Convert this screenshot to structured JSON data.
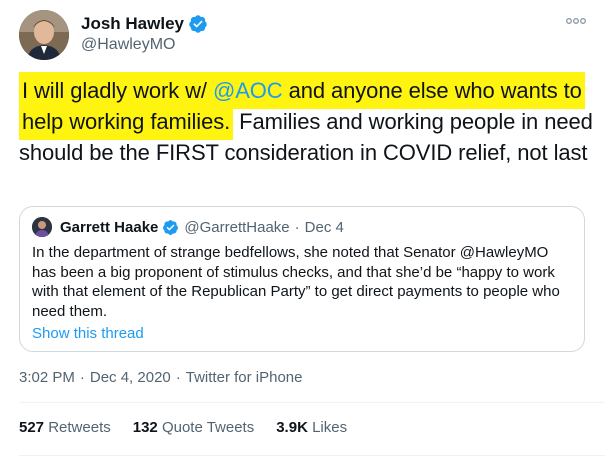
{
  "author": {
    "name": "Josh Hawley",
    "handle": "@HawleyMO",
    "avatar_icon": "avatar-photo",
    "verified_icon": "verified-badge-icon"
  },
  "tweet": {
    "highlight_1": "I will gladly work w/ ",
    "mention": "@AOC",
    "highlight_2": " and anyone else who wants to help working families.",
    "rest": " Families and working people in need should be the FIRST consideration in COVID relief, not last"
  },
  "quoted": {
    "name": "Garrett Haake",
    "handle": "@GarrettHaake",
    "dot": "·",
    "date": "Dec 4",
    "text": "In the department of strange bedfellows, she noted that Senator @HawleyMO has been a big proponent of stimulus checks, and that she’d be “happy to work with that element of the Republican Party” to get direct payments to people who need them.",
    "show_thread": "Show this thread"
  },
  "meta": {
    "time": "3:02 PM",
    "sep1": "·",
    "date": "Dec 4, 2020",
    "sep2": "·",
    "source": "Twitter for iPhone"
  },
  "stats": [
    {
      "count": "527",
      "label": "Retweets"
    },
    {
      "count": "132",
      "label": "Quote Tweets"
    },
    {
      "count": "3.9K",
      "label": "Likes"
    }
  ],
  "colors": {
    "highlight": "#fff40f",
    "link": "#1d9bf0",
    "secondary_text": "#536471"
  }
}
